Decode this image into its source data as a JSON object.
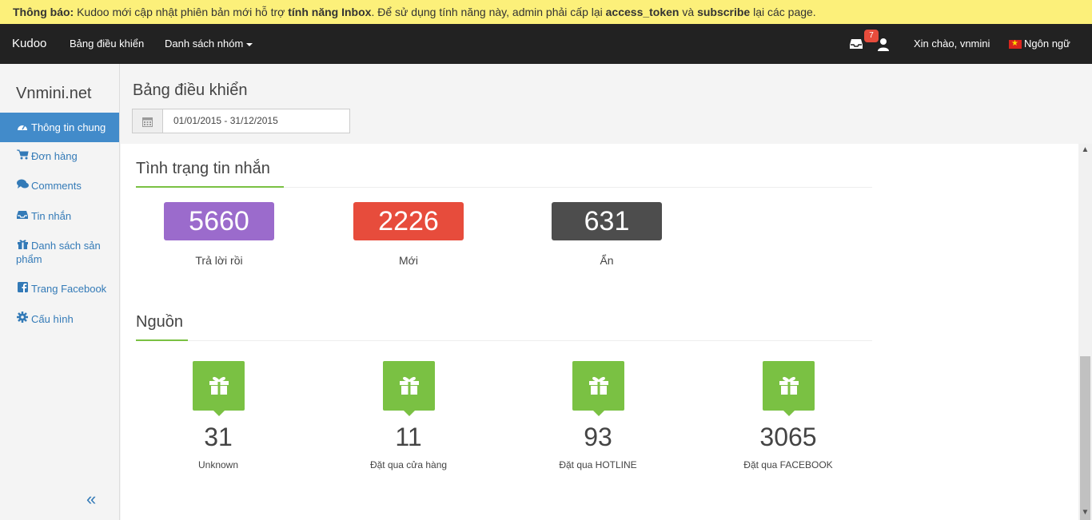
{
  "notice": {
    "prefix": "Thông báo:",
    "text1": " Kudoo mới cập nhật phiên bản mới hỗ trợ ",
    "feature": "tính năng Inbox",
    "text2": ". Để sử dụng tính năng này, admin phải cấp lại ",
    "token": "access_token",
    "text3": " và ",
    "subscribe": "subscribe",
    "text4": " lại các page."
  },
  "navbar": {
    "brand": "Kudoo",
    "dashboard": "Bảng điều khiển",
    "groups": "Danh sách nhóm",
    "inbox_badge": "7",
    "greeting": "Xin chào, vnmini",
    "language": "Ngôn ngữ"
  },
  "sidebar": {
    "site": "Vnmini.net",
    "items": [
      {
        "label": "Thông tin chung",
        "icon": "dashboard-icon"
      },
      {
        "label": "Đơn hàng",
        "icon": "cart-icon"
      },
      {
        "label": "Comments",
        "icon": "comments-icon"
      },
      {
        "label": "Tin nhắn",
        "icon": "inbox-icon"
      },
      {
        "label": "Danh sách sản phẩm",
        "icon": "gift-icon"
      },
      {
        "label": "Trang Facebook",
        "icon": "facebook-icon"
      },
      {
        "label": "Cấu hình",
        "icon": "gear-icon"
      }
    ],
    "collapse": "«"
  },
  "header": {
    "title": "Bảng điều khiển",
    "date_range": "01/01/2015 - 31/12/2015"
  },
  "messages": {
    "title": "Tình trạng tin nhắn",
    "stats": [
      {
        "value": "5660",
        "label": "Trả lời rồi",
        "color": "#9b6bcc"
      },
      {
        "value": "2226",
        "label": "Mới",
        "color": "#e74c3c"
      },
      {
        "value": "631",
        "label": "Ẩn",
        "color": "#4d4d4d"
      }
    ]
  },
  "sources": {
    "title": "Nguồn",
    "items": [
      {
        "value": "31",
        "label": "Unknown"
      },
      {
        "value": "11",
        "label": "Đặt qua cửa hàng"
      },
      {
        "value": "93",
        "label": "Đặt qua HOTLINE"
      },
      {
        "value": "3065",
        "label": "Đặt qua FACEBOOK"
      }
    ],
    "accent": "#7ac143"
  }
}
